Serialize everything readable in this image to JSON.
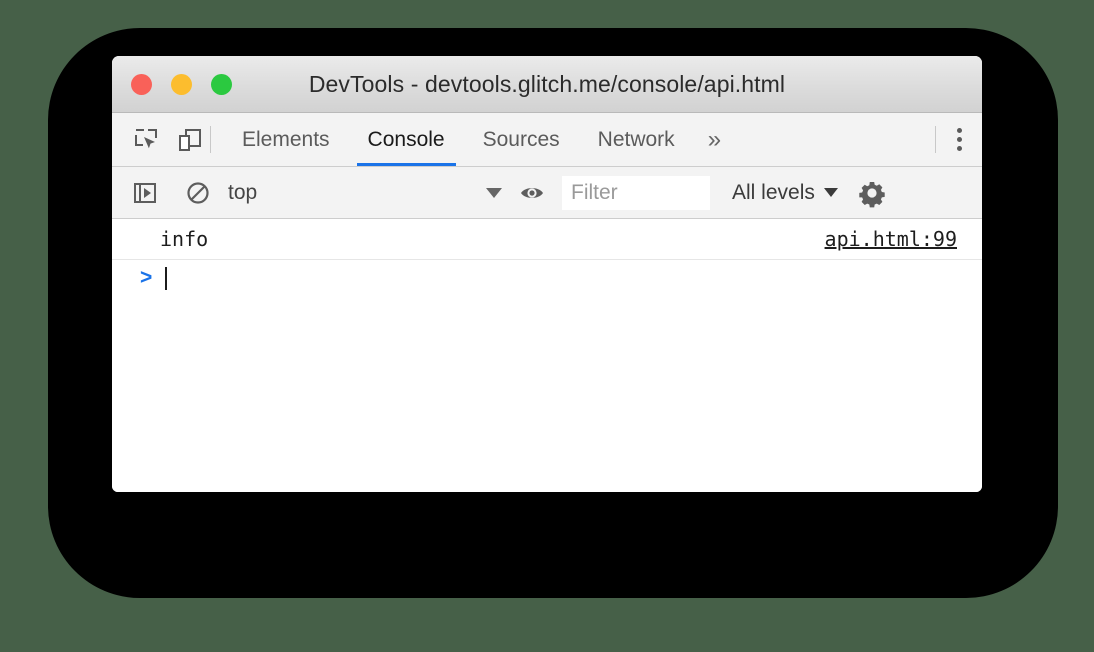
{
  "window": {
    "title": "DevTools - devtools.glitch.me/console/api.html",
    "traffic_lights": [
      {
        "name": "close",
        "color": "#f96159"
      },
      {
        "name": "minimize",
        "color": "#fcbd2e"
      },
      {
        "name": "zoom",
        "color": "#2bc940"
      }
    ]
  },
  "toolbar": {
    "inspect_icon": "inspect-element-icon",
    "device_icon": "device-toolbar-icon",
    "more_tabs_label": "»",
    "tabs": [
      {
        "label": "Elements",
        "active": false
      },
      {
        "label": "Console",
        "active": true
      },
      {
        "label": "Sources",
        "active": false
      },
      {
        "label": "Network",
        "active": false
      }
    ],
    "main_menu_icon": "kebab-menu-icon",
    "accent_color": "#1a73e8"
  },
  "console_toolbar": {
    "sidebar_toggle_icon": "console-sidebar-toggle-icon",
    "clear_icon": "clear-console-icon",
    "context": {
      "value": "top",
      "caret": "chevron-down-icon"
    },
    "eye_icon": "live-expression-eye-icon",
    "filter": {
      "value": "",
      "placeholder": "Filter"
    },
    "levels": {
      "value": "All levels",
      "caret": "chevron-down-icon"
    },
    "settings_icon": "gear-icon"
  },
  "console": {
    "messages": [
      {
        "text": "info",
        "source": "api.html:99"
      }
    ],
    "prompt": {
      "arrow": ">",
      "value": ""
    }
  },
  "colors": {
    "page_background": "#466048",
    "backdrop": "#000000",
    "window_background": "#ffffff",
    "toolbar_background": "#f3f3f3",
    "accent": "#1a73e8"
  }
}
